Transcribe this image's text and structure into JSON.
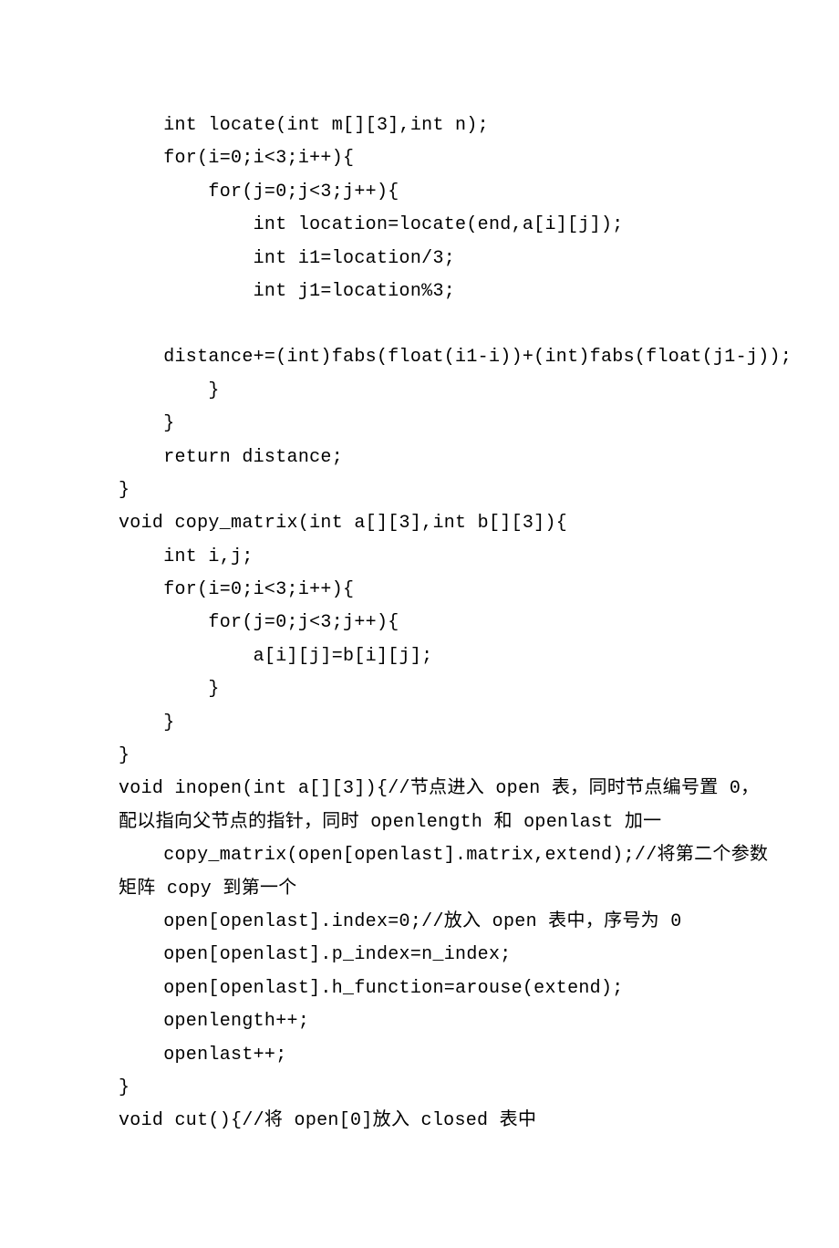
{
  "code": {
    "lines": [
      "    int locate(int m[][3],int n);",
      "    for(i=0;i<3;i++){",
      "        for(j=0;j<3;j++){",
      "            int location=locate(end,a[i][j]);",
      "            int i1=location/3;",
      "            int j1=location%3;",
      "",
      "    distance+=(int)fabs(float(i1-i))+(int)fabs(float(j1-j));",
      "        }",
      "    }",
      "    return distance;",
      "}",
      "void copy_matrix(int a[][3],int b[][3]){",
      "    int i,j;",
      "    for(i=0;i<3;i++){",
      "        for(j=0;j<3;j++){",
      "            a[i][j]=b[i][j];",
      "        }",
      "    }",
      "}",
      "void inopen(int a[][3]){//节点进入 open 表，同时节点编号置 0，",
      "配以指向父节点的指针，同时 openlength 和 openlast 加一",
      "    copy_matrix(open[openlast].matrix,extend);//将第二个参数",
      "矩阵 copy 到第一个",
      "    open[openlast].index=0;//放入 open 表中，序号为 0",
      "    open[openlast].p_index=n_index;",
      "    open[openlast].h_function=arouse(extend);",
      "    openlength++;",
      "    openlast++;",
      "}",
      "void cut(){//将 open[0]放入 closed 表中"
    ]
  }
}
